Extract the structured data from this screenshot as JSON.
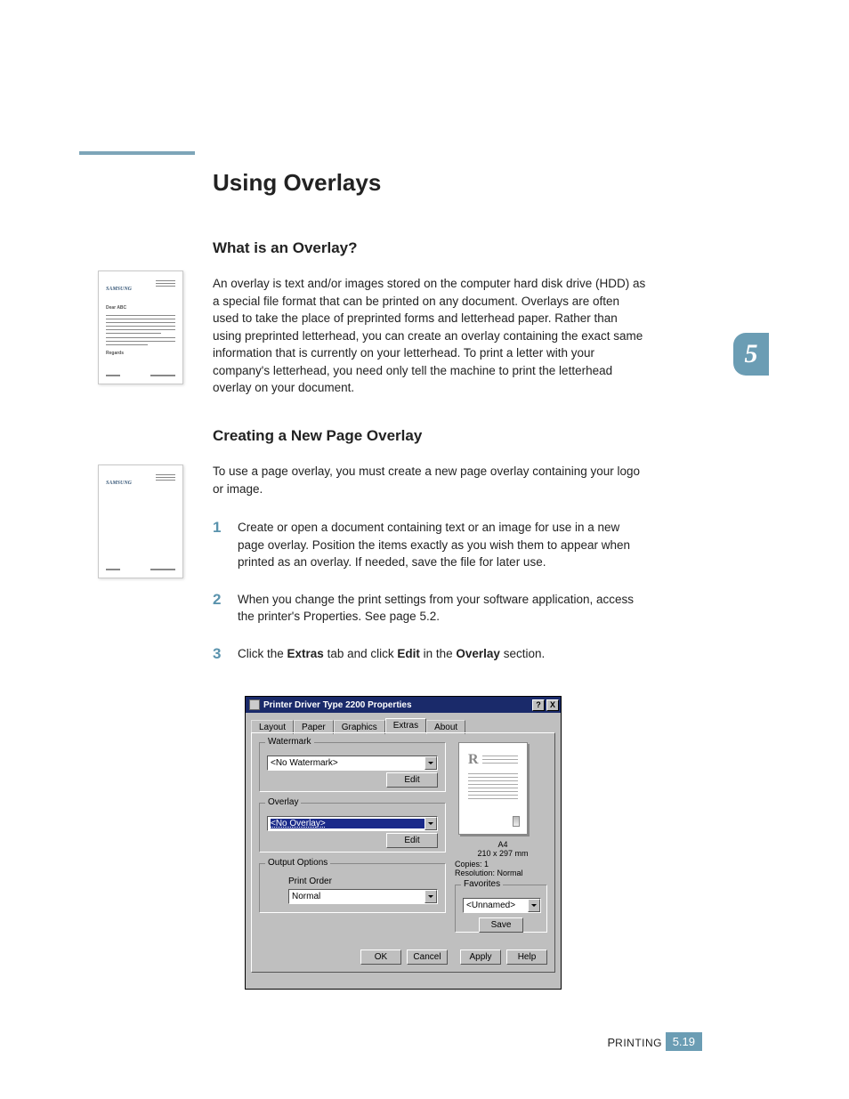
{
  "headings": {
    "h1": "Using Overlays",
    "h2_a": "What is an Overlay?",
    "h2_b": "Creating a New Page Overlay"
  },
  "paragraphs": {
    "overlay_def": "An overlay is text and/or images stored on the computer hard disk drive (HDD) as a special file format that can be printed on any document. Overlays are often used to take the place of preprinted forms and letterhead paper. Rather than using preprinted letterhead, you can create an overlay containing the exact same information that is currently on your letterhead. To print a letter with your company's letterhead, you need only tell the machine to print the letterhead overlay on your document.",
    "create_intro": "To use a page overlay, you must create a new page overlay containing your logo or image."
  },
  "steps": [
    "Create or open a document containing text or an image for use in a new page overlay. Position the items exactly as you wish them to appear when printed as an overlay. If needed, save the file for later use.",
    "When you change the print settings from your software application, access the printer's Properties. See page 5.2."
  ],
  "step3": {
    "prefix": "Click the ",
    "b1": "Extras",
    "mid1": " tab and click ",
    "b2": "Edit",
    "mid2": " in the ",
    "b3": "Overlay",
    "suffix": " section."
  },
  "step_nums": {
    "n1": "1",
    "n2": "2",
    "n3": "3"
  },
  "chapter_tab": "5",
  "footer": {
    "section_first": "P",
    "section_rest": "RINTING",
    "pagenum": "5.19"
  },
  "illus": {
    "brand": "SAMSUNG",
    "dear": "Dear ABC",
    "regards": "Regards"
  },
  "dialog": {
    "title": "Printer Driver Type 2200 Properties",
    "help_btn": "?",
    "close_btn": "X",
    "tabs": {
      "layout": "Layout",
      "paper": "Paper",
      "graphics": "Graphics",
      "extras": "Extras",
      "about": "About"
    },
    "groups": {
      "watermark": "Watermark",
      "overlay": "Overlay",
      "output": "Output Options",
      "favorites": "Favorites"
    },
    "combos": {
      "watermark": "<No Watermark>",
      "overlay": "<No Overlay>",
      "print_order_label": "Print Order",
      "print_order": "Normal",
      "favorites": "<Unnamed>"
    },
    "buttons": {
      "edit": "Edit",
      "save": "Save",
      "ok": "OK",
      "cancel": "Cancel",
      "apply": "Apply",
      "help": "Help"
    },
    "preview": {
      "r": "R",
      "paper_name": "A4",
      "paper_dim": "210 x 297 mm",
      "copies": "Copies: 1",
      "resolution": "Resolution: Normal"
    }
  }
}
